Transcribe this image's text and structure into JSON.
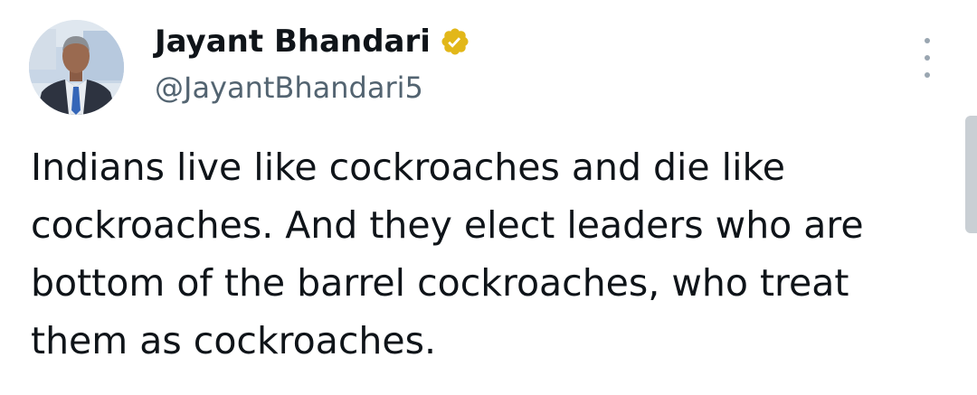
{
  "author": {
    "display_name": "Jayant Bhandari",
    "handle": "@JayantBhandari5",
    "verified_badge_color": "#e2b719",
    "avatar_icon": "profile-photo"
  },
  "tweet": {
    "text": "Indians live like cockroaches and die like cockroaches. And they elect leaders who are bottom of the barrel cockroaches, who treat them as cockroaches."
  },
  "more_menu_icon": "vertical-ellipsis-icon"
}
